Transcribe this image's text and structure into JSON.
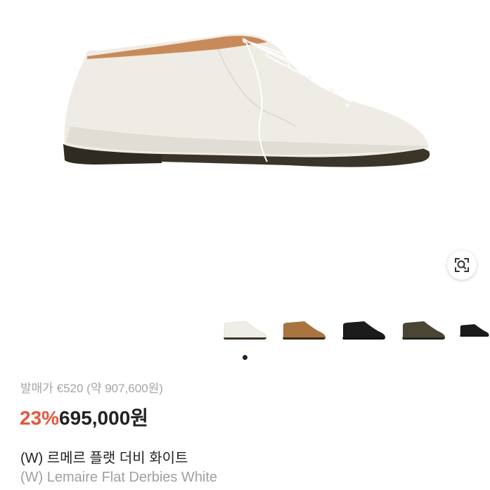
{
  "product": {
    "release_price": "발매가 €520 (약 907,600원)",
    "discount": "23%",
    "price": "695,000원",
    "name_ko": "(W) 르메르 플랫 더비 화이트",
    "name_en": "(W) Lemaire Flat Derbies White"
  },
  "gallery": {
    "thumbnail_colors": [
      "#f1efe9",
      "#a8743f",
      "#1b1b1b",
      "#4a4535",
      "#1b1b1b"
    ],
    "active_index": 0
  },
  "colors": {
    "discount": "#e4573a",
    "price": "#222222",
    "muted": "#a6a6a6"
  },
  "icons": {
    "image_search": "image-search-icon"
  }
}
